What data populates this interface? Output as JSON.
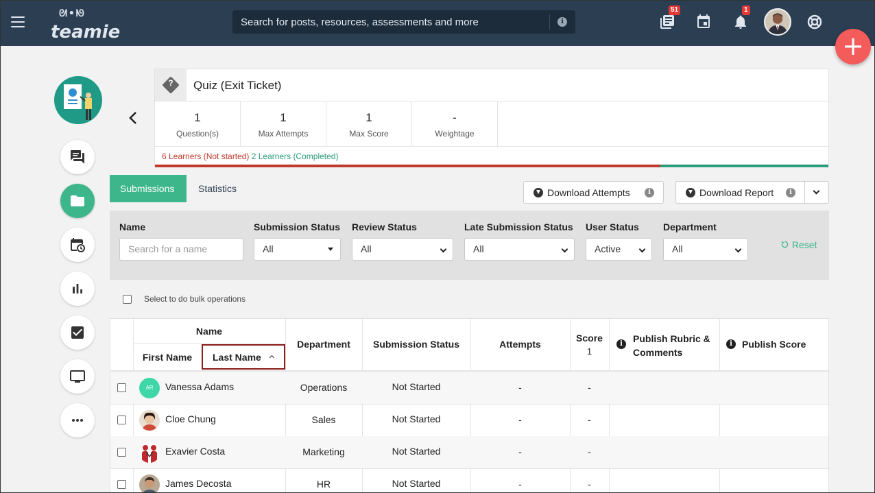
{
  "topbar": {
    "logo": "teamie",
    "search_placeholder": "Search for posts, resources, assessments and more",
    "resources_badge": "51",
    "notifications_badge": "1"
  },
  "quiz": {
    "title": "Quiz (Exit Ticket)",
    "stats": [
      {
        "value": "1",
        "label": "Question(s)"
      },
      {
        "value": "1",
        "label": "Max Attempts"
      },
      {
        "value": "1",
        "label": "Max Score"
      },
      {
        "value": "-",
        "label": "Weightage"
      }
    ],
    "not_started_text": "6 Learners (Not started)",
    "completed_text": "2 Learners (Completed)",
    "not_started_count": 6,
    "completed_count": 2
  },
  "tabs": {
    "submissions": "Submissions",
    "statistics": "Statistics"
  },
  "actions": {
    "download_attempts": "Download Attempts",
    "download_report": "Download Report"
  },
  "filters": {
    "name_label": "Name",
    "name_placeholder": "Search for a name",
    "submission_status_label": "Submission Status",
    "submission_status_value": "All",
    "review_status_label": "Review Status",
    "review_status_value": "All",
    "late_label": "Late Submission Status",
    "late_value": "All",
    "user_status_label": "User Status",
    "user_status_value": "Active",
    "department_label": "Department",
    "department_value": "All",
    "reset": "Reset"
  },
  "bulk_label": "Select to do bulk operations",
  "table": {
    "name_header": "Name",
    "first_name": "First Name",
    "last_name": "Last Name",
    "department": "Department",
    "submission_status": "Submission Status",
    "attempts": "Attempts",
    "score": "Score",
    "score_max": "1",
    "publish_rubric": "Publish Rubric & Comments",
    "publish_score": "Publish Score",
    "rows": [
      {
        "name": "Vanessa Adams",
        "initials": "AR",
        "department": "Operations",
        "status": "Not Started",
        "attempts": "-",
        "score": "-"
      },
      {
        "name": "Cloe Chung",
        "department": "Sales",
        "status": "Not Started",
        "attempts": "-",
        "score": "-"
      },
      {
        "name": "Exavier Costa",
        "department": "Marketing",
        "status": "Not Started",
        "attempts": "-",
        "score": "-"
      },
      {
        "name": "James Decosta",
        "department": "HR",
        "status": "Not Started",
        "attempts": "-",
        "score": "-"
      }
    ]
  },
  "colors": {
    "topbar": "#2c3e52",
    "accent": "#3cb68a",
    "not_started": "#c0392b",
    "completed": "#2a9d7c",
    "fab": "#f45b5b"
  }
}
